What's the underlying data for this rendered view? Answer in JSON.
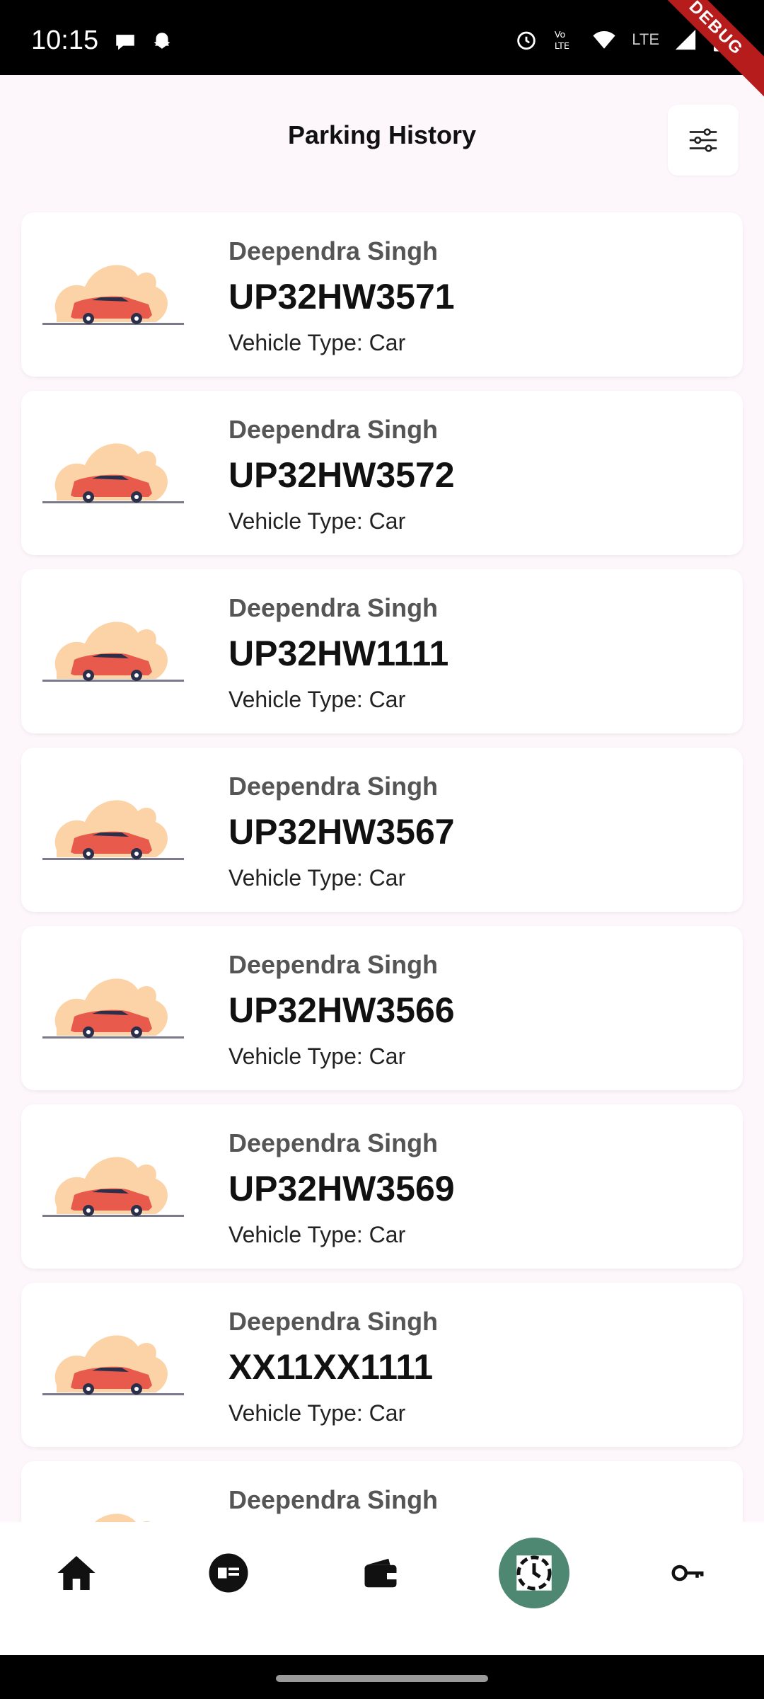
{
  "status_bar": {
    "time": "10:15",
    "network_label": "LTE",
    "icons": [
      "chat-bubble-icon",
      "snapchat-icon",
      "alarm-icon",
      "volte-icon",
      "wifi-icon",
      "signal-icon",
      "battery-icon"
    ]
  },
  "debug_banner": "DEBUG",
  "header": {
    "title": "Parking History",
    "filter_icon": "filter-sliders-icon"
  },
  "parking_list": [
    {
      "owner": "Deependra Singh",
      "plate": "UP32HW3571",
      "vehicle_type": "Vehicle Type: Car"
    },
    {
      "owner": "Deependra Singh",
      "plate": "UP32HW3572",
      "vehicle_type": "Vehicle Type: Car"
    },
    {
      "owner": "Deependra Singh",
      "plate": "UP32HW1111",
      "vehicle_type": "Vehicle Type: Car"
    },
    {
      "owner": "Deependra Singh",
      "plate": "UP32HW3567",
      "vehicle_type": "Vehicle Type: Car"
    },
    {
      "owner": "Deependra Singh",
      "plate": "UP32HW3566",
      "vehicle_type": "Vehicle Type: Car"
    },
    {
      "owner": "Deependra Singh",
      "plate": "UP32HW3569",
      "vehicle_type": "Vehicle Type: Car"
    },
    {
      "owner": "Deependra Singh",
      "plate": "XX11XX1111",
      "vehicle_type": "Vehicle Type: Car"
    },
    {
      "owner": "Deependra Singh",
      "plate": "",
      "vehicle_type": ""
    }
  ],
  "bottom_nav": {
    "items": [
      {
        "icon": "home-icon",
        "active": false
      },
      {
        "icon": "id-card-icon",
        "active": false
      },
      {
        "icon": "wallet-icon",
        "active": false
      },
      {
        "icon": "history-clock-icon",
        "active": true
      },
      {
        "icon": "key-icon",
        "active": false
      }
    ],
    "active_color": "#4e8772"
  },
  "colors": {
    "background": "#fdf7fb",
    "car_body": "#e85b4c",
    "illustration_blob": "#fcd3a6",
    "debug_ribbon": "#b71c1c"
  }
}
